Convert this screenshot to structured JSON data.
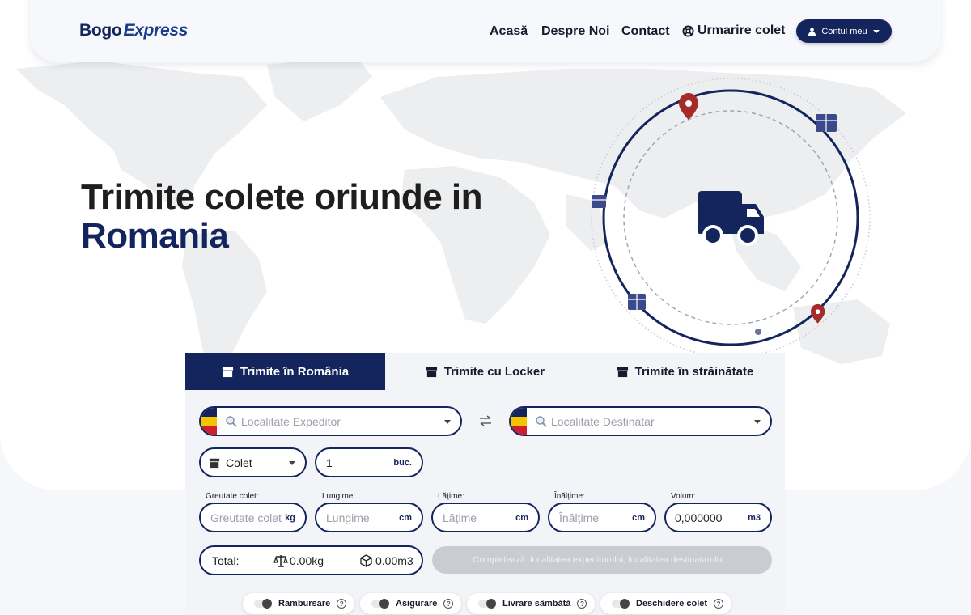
{
  "brand": {
    "logo_part1": "Bogo",
    "logo_part2": "Express"
  },
  "nav": {
    "links": [
      "Acasă",
      "Despre Noi",
      "Contact"
    ],
    "tracking": "Urmarire colet",
    "account": "Contul meu"
  },
  "hero": {
    "title_line1": "Trimite colete oriunde in",
    "title_line2": "Romania"
  },
  "tabs": [
    {
      "label": "Trimite în România",
      "active": true
    },
    {
      "label": "Trimite cu Locker",
      "active": false
    },
    {
      "label": "Trimite în străinătate",
      "active": false
    }
  ],
  "form": {
    "sender_placeholder": "Localitate Expeditor",
    "recipient_placeholder": "Localitate Destinatar",
    "package_type": "Colet",
    "quantity": "1",
    "quantity_unit": "buc.",
    "weight": {
      "label": "Greutate colet:",
      "placeholder": "Greutate colet",
      "unit": "kg"
    },
    "length": {
      "label": "Lungime:",
      "placeholder": "Lungime",
      "unit": "cm"
    },
    "width": {
      "label": "Lățime:",
      "placeholder": "Lățime",
      "unit": "cm"
    },
    "height": {
      "label": "Înălțime:",
      "placeholder": "Înălțime",
      "unit": "cm"
    },
    "volume": {
      "label": "Volum:",
      "value": "0,000000",
      "unit": "m3"
    },
    "total_label": "Total:",
    "total_weight": "0.00kg",
    "total_volume": "0.00m3",
    "submit_label": "Completează: localitatea expeditorului, localitatea destinatarului..."
  },
  "options": [
    {
      "label": "Rambursare"
    },
    {
      "label": "Asigurare"
    },
    {
      "label": "Livrare sâmbătă"
    },
    {
      "label": "Deschidere colet"
    }
  ],
  "colors": {
    "primary": "#14245c",
    "pin": "#a52a2a",
    "flag_blue": "#14245c",
    "flag_yellow": "#f5c400",
    "flag_red": "#cc1f2f"
  }
}
